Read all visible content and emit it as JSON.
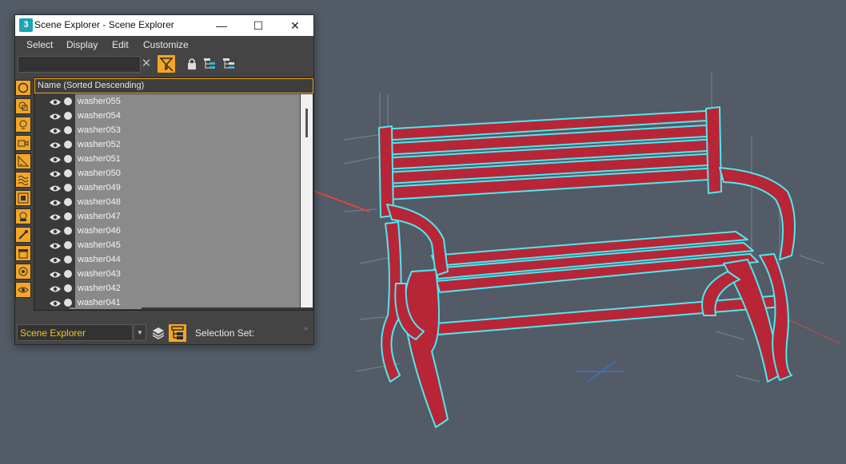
{
  "window": {
    "app_icon_text": "3",
    "title": "Scene Explorer - Scene Explorer",
    "minimize_glyph": "—",
    "maximize_glyph": "☐",
    "close_glyph": "✕"
  },
  "menu": [
    "Select",
    "Display",
    "Edit",
    "Customize"
  ],
  "toolbar": {
    "search_value": "",
    "clear_glyph": "✕",
    "icons": [
      "filter-icon",
      "lock-icon",
      "hierarchy-icon",
      "dependency-icon"
    ]
  },
  "sidebar": {
    "icons": [
      "sphere-icon",
      "shapes-icon",
      "light-icon",
      "camera-icon",
      "helper-icon",
      "spacewarp-icon",
      "group-icon",
      "xref-icon",
      "bone-icon",
      "container-icon",
      "particle-icon",
      "hidden-eye-icon"
    ],
    "more": "»"
  },
  "list": {
    "column_header": "Name (Sorted Descending)",
    "rows": [
      "washer055",
      "washer054",
      "washer053",
      "washer052",
      "washer051",
      "washer050",
      "washer049",
      "washer048",
      "washer047",
      "washer046",
      "washer045",
      "washer044",
      "washer043",
      "washer042",
      "washer041"
    ]
  },
  "bottom": {
    "explorer_name": "Scene Explorer",
    "dropdown_glyph": "▼",
    "selection_set_label": "Selection Set:",
    "corner_glyph": "»"
  },
  "colors": {
    "accent": "#f5a623",
    "bench_red": "#c0283a",
    "selection_cyan": "#4de8f0",
    "arrow_red": "#e0463e",
    "viewport_bg": "#535b66"
  }
}
